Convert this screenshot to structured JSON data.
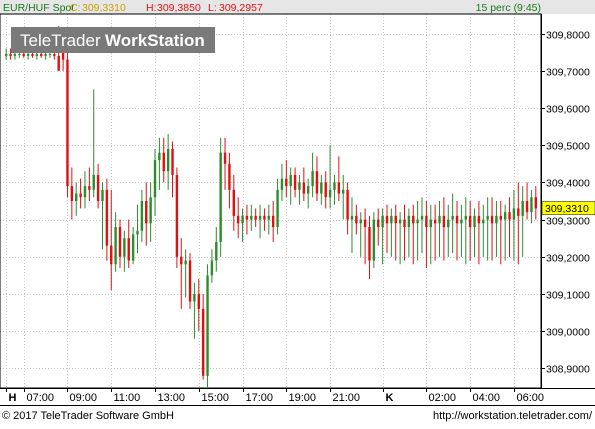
{
  "header": {
    "symbol": "EUR/HUF Spot",
    "close_label": "C:",
    "close_value": "309,3310",
    "high_label": "H:",
    "high_value": "309,3850",
    "low_label": "L:",
    "low_value": "309,2957",
    "interval_text": "15 perc (9:45)"
  },
  "watermark": {
    "left": "TeleTrader",
    "right": "WorkStation"
  },
  "footer": {
    "copyright": "© 2017 TeleTrader Software GmbH",
    "url": "http://workstation.teletrader.com/"
  },
  "colors": {
    "up": "#2e8b2e",
    "down": "#e01010",
    "grid": "#c8c8c8",
    "last_price_bg": "#ffff00",
    "header_bg": "#e6e6e6",
    "axis_text": "#000000"
  },
  "chart_data": {
    "type": "candlestick",
    "interval": "15 min",
    "ylim": [
      308.85,
      309.85
    ],
    "y_ticks": [
      "309,8000",
      "309,7000",
      "309,6000",
      "309,5000",
      "309,4000",
      "309,3000",
      "309,2000",
      "309,1000",
      "309,0000",
      "308,9000"
    ],
    "y_tick_values": [
      309.8,
      309.7,
      309.6,
      309.5,
      309.4,
      309.3,
      309.2,
      309.1,
      309.0,
      308.9
    ],
    "last_price_label": "309,3310",
    "last_price": 309.331,
    "x_ticks": [
      {
        "label": "H",
        "bold": true,
        "index": 0
      },
      {
        "label": "07:00",
        "bold": false,
        "index": 4
      },
      {
        "label": "09:00",
        "bold": false,
        "index": 14
      },
      {
        "label": "11:00",
        "bold": false,
        "index": 24
      },
      {
        "label": "13:00",
        "bold": false,
        "index": 34
      },
      {
        "label": "15:00",
        "bold": false,
        "index": 44
      },
      {
        "label": "17:00",
        "bold": false,
        "index": 54
      },
      {
        "label": "19:00",
        "bold": false,
        "index": 64
      },
      {
        "label": "21:00",
        "bold": false,
        "index": 74
      },
      {
        "label": "K",
        "bold": true,
        "index": 86
      },
      {
        "label": "02:00",
        "bold": false,
        "index": 96
      },
      {
        "label": "04:00",
        "bold": false,
        "index": 106
      },
      {
        "label": "06:00",
        "bold": false,
        "index": 116
      }
    ],
    "candles": [
      {
        "o": 309.74,
        "h": 309.76,
        "l": 309.73,
        "c": 309.745
      },
      {
        "o": 309.745,
        "h": 309.76,
        "l": 309.73,
        "c": 309.74
      },
      {
        "o": 309.74,
        "h": 309.755,
        "l": 309.73,
        "c": 309.745
      },
      {
        "o": 309.745,
        "h": 309.76,
        "l": 309.735,
        "c": 309.745
      },
      {
        "o": 309.745,
        "h": 309.76,
        "l": 309.735,
        "c": 309.74
      },
      {
        "o": 309.74,
        "h": 309.75,
        "l": 309.73,
        "c": 309.745
      },
      {
        "o": 309.745,
        "h": 309.76,
        "l": 309.735,
        "c": 309.74
      },
      {
        "o": 309.74,
        "h": 309.755,
        "l": 309.73,
        "c": 309.745
      },
      {
        "o": 309.745,
        "h": 309.76,
        "l": 309.735,
        "c": 309.74
      },
      {
        "o": 309.74,
        "h": 309.755,
        "l": 309.73,
        "c": 309.745
      },
      {
        "o": 309.745,
        "h": 309.76,
        "l": 309.735,
        "c": 309.745
      },
      {
        "o": 309.745,
        "h": 309.76,
        "l": 309.73,
        "c": 309.74
      },
      {
        "o": 309.74,
        "h": 309.82,
        "l": 309.72,
        "c": 309.7
      },
      {
        "o": 309.75,
        "h": 309.78,
        "l": 309.7,
        "c": 309.73
      },
      {
        "o": 309.73,
        "h": 309.75,
        "l": 309.36,
        "c": 309.39
      },
      {
        "o": 309.39,
        "h": 309.44,
        "l": 309.3,
        "c": 309.35
      },
      {
        "o": 309.35,
        "h": 309.4,
        "l": 309.31,
        "c": 309.37
      },
      {
        "o": 309.37,
        "h": 309.41,
        "l": 309.33,
        "c": 309.36
      },
      {
        "o": 309.36,
        "h": 309.43,
        "l": 309.33,
        "c": 309.39
      },
      {
        "o": 309.39,
        "h": 309.44,
        "l": 309.35,
        "c": 309.38
      },
      {
        "o": 309.38,
        "h": 309.65,
        "l": 309.36,
        "c": 309.42
      },
      {
        "o": 309.42,
        "h": 309.45,
        "l": 309.33,
        "c": 309.35
      },
      {
        "o": 309.35,
        "h": 309.4,
        "l": 309.22,
        "c": 309.38
      },
      {
        "o": 309.38,
        "h": 309.41,
        "l": 309.19,
        "c": 309.23
      },
      {
        "o": 309.23,
        "h": 309.38,
        "l": 309.11,
        "c": 309.18
      },
      {
        "o": 309.18,
        "h": 309.32,
        "l": 309.16,
        "c": 309.28
      },
      {
        "o": 309.28,
        "h": 309.3,
        "l": 309.17,
        "c": 309.2
      },
      {
        "o": 309.2,
        "h": 309.27,
        "l": 309.16,
        "c": 309.25
      },
      {
        "o": 309.25,
        "h": 309.3,
        "l": 309.17,
        "c": 309.19
      },
      {
        "o": 309.19,
        "h": 309.28,
        "l": 309.18,
        "c": 309.26
      },
      {
        "o": 309.26,
        "h": 309.34,
        "l": 309.21,
        "c": 309.27
      },
      {
        "o": 309.27,
        "h": 309.38,
        "l": 309.24,
        "c": 309.35
      },
      {
        "o": 309.35,
        "h": 309.4,
        "l": 309.23,
        "c": 309.29
      },
      {
        "o": 309.29,
        "h": 309.4,
        "l": 309.24,
        "c": 309.36
      },
      {
        "o": 309.36,
        "h": 309.49,
        "l": 309.31,
        "c": 309.46
      },
      {
        "o": 309.46,
        "h": 309.52,
        "l": 309.38,
        "c": 309.48
      },
      {
        "o": 309.48,
        "h": 309.52,
        "l": 309.4,
        "c": 309.43
      },
      {
        "o": 309.43,
        "h": 309.53,
        "l": 309.38,
        "c": 309.49
      },
      {
        "o": 309.49,
        "h": 309.51,
        "l": 309.36,
        "c": 309.42
      },
      {
        "o": 309.42,
        "h": 309.44,
        "l": 309.17,
        "c": 309.2
      },
      {
        "o": 309.2,
        "h": 309.25,
        "l": 309.06,
        "c": 309.18
      },
      {
        "o": 309.18,
        "h": 309.22,
        "l": 309.09,
        "c": 309.19
      },
      {
        "o": 309.19,
        "h": 309.21,
        "l": 309.06,
        "c": 309.08
      },
      {
        "o": 309.08,
        "h": 309.13,
        "l": 308.98,
        "c": 309.1
      },
      {
        "o": 309.1,
        "h": 309.14,
        "l": 309.0,
        "c": 309.06
      },
      {
        "o": 309.06,
        "h": 309.1,
        "l": 308.87,
        "c": 308.88
      },
      {
        "o": 308.88,
        "h": 309.18,
        "l": 308.85,
        "c": 309.15
      },
      {
        "o": 309.15,
        "h": 309.22,
        "l": 309.13,
        "c": 309.19
      },
      {
        "o": 309.19,
        "h": 309.28,
        "l": 309.16,
        "c": 309.24
      },
      {
        "o": 309.24,
        "h": 309.52,
        "l": 309.2,
        "c": 309.48
      },
      {
        "o": 309.48,
        "h": 309.52,
        "l": 309.38,
        "c": 309.45
      },
      {
        "o": 309.45,
        "h": 309.48,
        "l": 309.33,
        "c": 309.38
      },
      {
        "o": 309.38,
        "h": 309.42,
        "l": 309.27,
        "c": 309.31
      },
      {
        "o": 309.31,
        "h": 309.36,
        "l": 309.25,
        "c": 309.29
      },
      {
        "o": 309.29,
        "h": 309.33,
        "l": 309.24,
        "c": 309.31
      },
      {
        "o": 309.31,
        "h": 309.34,
        "l": 309.26,
        "c": 309.3
      },
      {
        "o": 309.3,
        "h": 309.34,
        "l": 309.27,
        "c": 309.31
      },
      {
        "o": 309.31,
        "h": 309.33,
        "l": 309.28,
        "c": 309.3
      },
      {
        "o": 309.3,
        "h": 309.34,
        "l": 309.25,
        "c": 309.31
      },
      {
        "o": 309.31,
        "h": 309.33,
        "l": 309.27,
        "c": 309.3
      },
      {
        "o": 309.3,
        "h": 309.34,
        "l": 309.26,
        "c": 309.31
      },
      {
        "o": 309.31,
        "h": 309.35,
        "l": 309.24,
        "c": 309.28
      },
      {
        "o": 309.28,
        "h": 309.41,
        "l": 309.26,
        "c": 309.38
      },
      {
        "o": 309.38,
        "h": 309.45,
        "l": 309.35,
        "c": 309.41
      },
      {
        "o": 309.41,
        "h": 309.46,
        "l": 309.36,
        "c": 309.39
      },
      {
        "o": 309.39,
        "h": 309.44,
        "l": 309.34,
        "c": 309.42
      },
      {
        "o": 309.42,
        "h": 309.44,
        "l": 309.36,
        "c": 309.38
      },
      {
        "o": 309.38,
        "h": 309.42,
        "l": 309.34,
        "c": 309.4
      },
      {
        "o": 309.4,
        "h": 309.44,
        "l": 309.35,
        "c": 309.37
      },
      {
        "o": 309.37,
        "h": 309.41,
        "l": 309.33,
        "c": 309.39
      },
      {
        "o": 309.39,
        "h": 309.48,
        "l": 309.36,
        "c": 309.43
      },
      {
        "o": 309.43,
        "h": 309.47,
        "l": 309.35,
        "c": 309.37
      },
      {
        "o": 309.37,
        "h": 309.42,
        "l": 309.34,
        "c": 309.4
      },
      {
        "o": 309.4,
        "h": 309.43,
        "l": 309.33,
        "c": 309.36
      },
      {
        "o": 309.36,
        "h": 309.5,
        "l": 309.33,
        "c": 309.38
      },
      {
        "o": 309.38,
        "h": 309.42,
        "l": 309.34,
        "c": 309.4
      },
      {
        "o": 309.4,
        "h": 309.47,
        "l": 309.35,
        "c": 309.37
      },
      {
        "o": 309.37,
        "h": 309.42,
        "l": 309.3,
        "c": 309.38
      },
      {
        "o": 309.38,
        "h": 309.4,
        "l": 309.26,
        "c": 309.3
      },
      {
        "o": 309.3,
        "h": 309.36,
        "l": 309.21,
        "c": 309.31
      },
      {
        "o": 309.31,
        "h": 309.34,
        "l": 309.26,
        "c": 309.29
      },
      {
        "o": 309.29,
        "h": 309.32,
        "l": 309.2,
        "c": 309.3
      },
      {
        "o": 309.3,
        "h": 309.33,
        "l": 309.18,
        "c": 309.28
      },
      {
        "o": 309.28,
        "h": 309.31,
        "l": 309.14,
        "c": 309.19
      },
      {
        "o": 309.19,
        "h": 309.32,
        "l": 309.17,
        "c": 309.3
      },
      {
        "o": 309.3,
        "h": 309.33,
        "l": 309.23,
        "c": 309.28
      },
      {
        "o": 309.28,
        "h": 309.33,
        "l": 309.18,
        "c": 309.31
      },
      {
        "o": 309.31,
        "h": 309.34,
        "l": 309.21,
        "c": 309.29
      },
      {
        "o": 309.29,
        "h": 309.33,
        "l": 309.2,
        "c": 309.31
      },
      {
        "o": 309.31,
        "h": 309.34,
        "l": 309.19,
        "c": 309.29
      },
      {
        "o": 309.29,
        "h": 309.32,
        "l": 309.18,
        "c": 309.3
      },
      {
        "o": 309.3,
        "h": 309.34,
        "l": 309.19,
        "c": 309.28
      },
      {
        "o": 309.28,
        "h": 309.33,
        "l": 309.2,
        "c": 309.31
      },
      {
        "o": 309.31,
        "h": 309.34,
        "l": 309.18,
        "c": 309.29
      },
      {
        "o": 309.29,
        "h": 309.35,
        "l": 309.19,
        "c": 309.3
      },
      {
        "o": 309.3,
        "h": 309.36,
        "l": 309.21,
        "c": 309.31
      },
      {
        "o": 309.31,
        "h": 309.35,
        "l": 309.17,
        "c": 309.28
      },
      {
        "o": 309.28,
        "h": 309.34,
        "l": 309.18,
        "c": 309.3
      },
      {
        "o": 309.3,
        "h": 309.34,
        "l": 309.19,
        "c": 309.29
      },
      {
        "o": 309.29,
        "h": 309.35,
        "l": 309.2,
        "c": 309.31
      },
      {
        "o": 309.31,
        "h": 309.36,
        "l": 309.19,
        "c": 309.28
      },
      {
        "o": 309.28,
        "h": 309.34,
        "l": 309.2,
        "c": 309.3
      },
      {
        "o": 309.3,
        "h": 309.37,
        "l": 309.21,
        "c": 309.31
      },
      {
        "o": 309.31,
        "h": 309.35,
        "l": 309.19,
        "c": 309.29
      },
      {
        "o": 309.29,
        "h": 309.34,
        "l": 309.2,
        "c": 309.3
      },
      {
        "o": 309.3,
        "h": 309.36,
        "l": 309.18,
        "c": 309.31
      },
      {
        "o": 309.31,
        "h": 309.35,
        "l": 309.19,
        "c": 309.28
      },
      {
        "o": 309.28,
        "h": 309.33,
        "l": 309.2,
        "c": 309.31
      },
      {
        "o": 309.31,
        "h": 309.35,
        "l": 309.18,
        "c": 309.29
      },
      {
        "o": 309.29,
        "h": 309.34,
        "l": 309.2,
        "c": 309.3
      },
      {
        "o": 309.3,
        "h": 309.36,
        "l": 309.19,
        "c": 309.31
      },
      {
        "o": 309.31,
        "h": 309.36,
        "l": 309.19,
        "c": 309.29
      },
      {
        "o": 309.29,
        "h": 309.35,
        "l": 309.2,
        "c": 309.31
      },
      {
        "o": 309.31,
        "h": 309.35,
        "l": 309.18,
        "c": 309.3
      },
      {
        "o": 309.3,
        "h": 309.34,
        "l": 309.19,
        "c": 309.32
      },
      {
        "o": 309.32,
        "h": 309.36,
        "l": 309.2,
        "c": 309.3
      },
      {
        "o": 309.3,
        "h": 309.38,
        "l": 309.19,
        "c": 309.33
      },
      {
        "o": 309.33,
        "h": 309.4,
        "l": 309.18,
        "c": 309.31
      },
      {
        "o": 309.31,
        "h": 309.39,
        "l": 309.2,
        "c": 309.35
      },
      {
        "o": 309.35,
        "h": 309.4,
        "l": 309.3,
        "c": 309.32
      },
      {
        "o": 309.32,
        "h": 309.38,
        "l": 309.29,
        "c": 309.36
      },
      {
        "o": 309.36,
        "h": 309.39,
        "l": 309.3,
        "c": 309.33
      }
    ]
  }
}
